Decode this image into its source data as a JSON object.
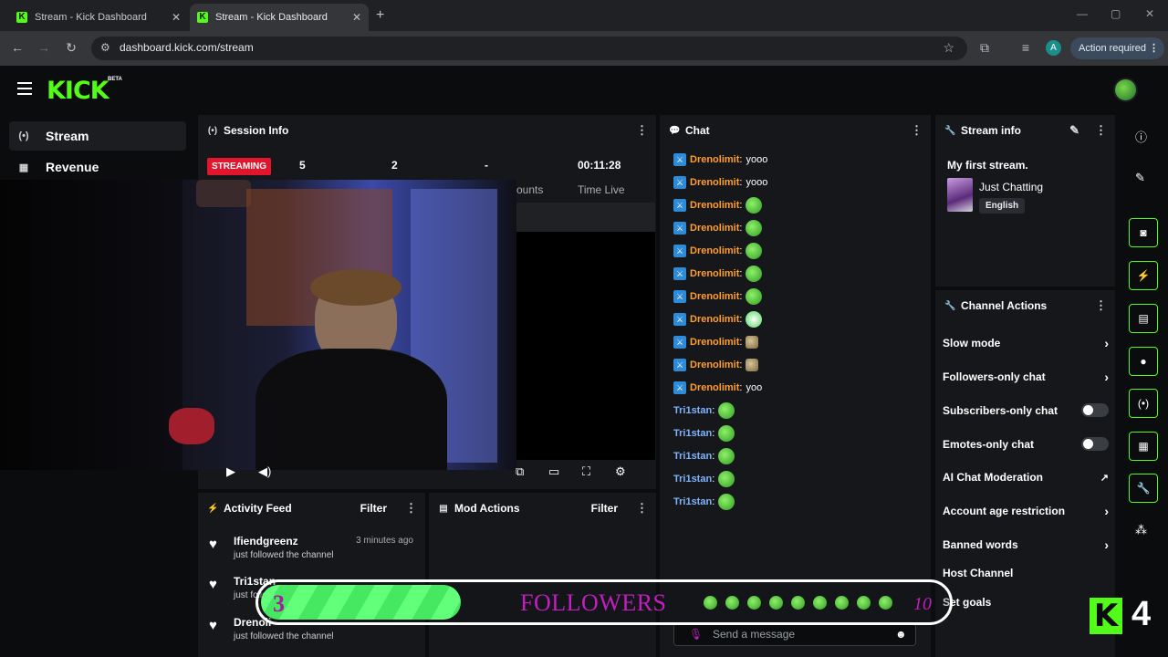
{
  "browser": {
    "tabs": [
      {
        "title": "Stream - Kick Dashboard",
        "active": false
      },
      {
        "title": "Stream - Kick Dashboard",
        "active": true
      }
    ],
    "url": "dashboard.kick.com/stream",
    "profile_initial": "A",
    "action_required": "Action required"
  },
  "header": {
    "logo": "KICK",
    "beta": "BETA"
  },
  "sidebar": {
    "items": [
      {
        "label": "Stream",
        "icon": "broadcast-icon",
        "active": true
      },
      {
        "label": "Revenue",
        "icon": "chart-icon",
        "active": false
      }
    ]
  },
  "session_info": {
    "title": "Session Info",
    "status": "STREAMING",
    "stats": [
      {
        "value": "5",
        "label": ""
      },
      {
        "value": "2",
        "label": ""
      },
      {
        "value": "-",
        "label": "ounts"
      },
      {
        "value": "00:11:28",
        "label": "Time Live"
      }
    ]
  },
  "chat": {
    "title": "Chat",
    "messages": [
      {
        "user": "Drenolimit",
        "text": "yooo",
        "emote": ""
      },
      {
        "user": "Drenolimit",
        "text": "yooo",
        "emote": ""
      },
      {
        "user": "Drenolimit",
        "text": "",
        "emote": "green"
      },
      {
        "user": "Drenolimit",
        "text": "",
        "emote": "green"
      },
      {
        "user": "Drenolimit",
        "text": "",
        "emote": "green"
      },
      {
        "user": "Drenolimit",
        "text": "",
        "emote": "green"
      },
      {
        "user": "Drenolimit",
        "text": "",
        "emote": "green"
      },
      {
        "user": "Drenolimit",
        "text": "",
        "emote": "white"
      },
      {
        "user": "Drenolimit",
        "text": "",
        "emote": "brown"
      },
      {
        "user": "Drenolimit",
        "text": "",
        "emote": "brown"
      },
      {
        "user": "Drenolimit",
        "text": "yoo",
        "emote": ""
      },
      {
        "user": "Tri1stan",
        "text": "",
        "emote": "green"
      },
      {
        "user": "Tri1stan",
        "text": "",
        "emote": "green"
      },
      {
        "user": "Tri1stan",
        "text": "",
        "emote": "green"
      },
      {
        "user": "Tri1stan",
        "text": "",
        "emote": "green"
      },
      {
        "user": "Tri1stan",
        "text": "",
        "emote": "green"
      }
    ],
    "input_placeholder": "Send a message"
  },
  "stream_info": {
    "title": "Stream info",
    "stream_title": "My first stream.",
    "category": "Just Chatting",
    "language": "English"
  },
  "channel_actions": {
    "title": "Channel Actions",
    "items": [
      {
        "label": "Slow mode",
        "control": "chevron"
      },
      {
        "label": "Followers-only chat",
        "control": "chevron"
      },
      {
        "label": "Subscribers-only chat",
        "control": "toggle"
      },
      {
        "label": "Emotes-only chat",
        "control": "toggle"
      },
      {
        "label": "AI Chat Moderation",
        "control": "external"
      },
      {
        "label": "Account age restriction",
        "control": "chevron"
      },
      {
        "label": "Banned words",
        "control": "chevron"
      },
      {
        "label": "Host Channel",
        "control": "none"
      },
      {
        "label": "Set goals",
        "control": "none"
      }
    ]
  },
  "activity_feed": {
    "title": "Activity Feed",
    "filter": "Filter",
    "items": [
      {
        "name": "Ifiendgreenz",
        "time": "3 minutes ago",
        "sub": "just followed the channel"
      },
      {
        "name": "Tri1stan",
        "time": "",
        "sub": "just followed the channel"
      },
      {
        "name": "Drenoli",
        "time": "",
        "sub": "just followed the channel"
      }
    ]
  },
  "mod_actions": {
    "title": "Mod Actions",
    "filter": "Filter"
  },
  "follower_goal": {
    "current": "3",
    "label": "FOLLOWERS",
    "goal": "10",
    "progress": 0.3
  },
  "overlay_badge": {
    "logo": "K",
    "number": "4"
  },
  "colors": {
    "accent": "#53fc18",
    "streaming": "#e1162d",
    "panel": "#16171a",
    "bg": "#0b0c0e"
  }
}
